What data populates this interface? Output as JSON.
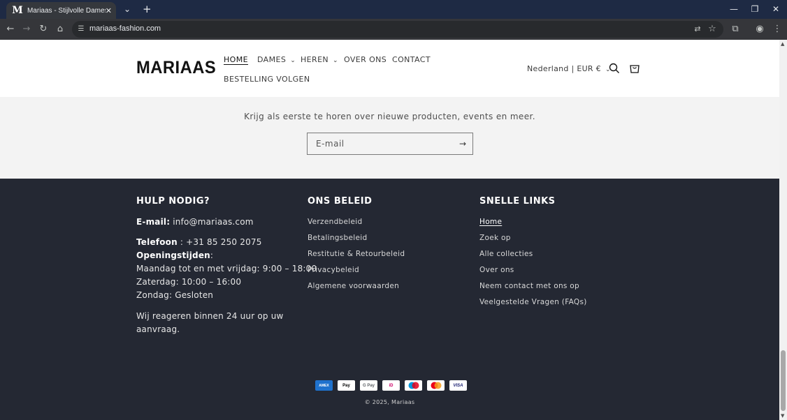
{
  "browser": {
    "tab_favicon": "M",
    "tab_title": "Mariaas - Stijlvolle Dames- & H",
    "tab_close": "✕",
    "tab_list": "⌄",
    "new_tab": "+",
    "url": "mariaas-fashion.com",
    "window": {
      "minimize": "—",
      "restore": "❐",
      "close": "✕"
    },
    "nav_icons": {
      "back": "←",
      "forward": "→",
      "reload": "↻",
      "home": "⌂",
      "site_info": "☰",
      "translate": "⇄",
      "bookmark": "☆",
      "extensions": "⧉",
      "profile": "◉",
      "menu": "⋮"
    }
  },
  "header": {
    "logo": "MARIAAS",
    "menu": [
      {
        "label": "HOME",
        "active": true
      },
      {
        "label": "DAMES",
        "dropdown": true
      },
      {
        "label": "HEREN",
        "dropdown": true
      },
      {
        "label": "OVER ONS"
      },
      {
        "label": "CONTACT"
      },
      {
        "label": "BESTELLING VOLGEN"
      }
    ],
    "chevron": "⌄",
    "locale": "Nederland | EUR €"
  },
  "newsletter": {
    "text": "Krijg als eerste te horen over nieuwe producten, events en meer.",
    "placeholder": "E-mail",
    "submit_arrow": "→"
  },
  "footer": {
    "help": {
      "title": "HULP NODIG?",
      "email_label": "E-mail:",
      "email": " info@mariaas.com",
      "phone_label": "Telefoon",
      "phone": " : +31 85 250 2075",
      "hours_label": "Openingstijden",
      "hours_colon": ":",
      "weekdays": "Maandag tot en met vrijdag: 9:00 – 18:00",
      "saturday": "Zaterdag: 10:00 – 16:00",
      "sunday": "Zondag: Gesloten",
      "response_1": "Wij reageren binnen 24 uur op uw",
      "response_2": "aanvraag."
    },
    "policy": {
      "title": "ONS BELEID",
      "links": [
        "Verzendbeleid",
        "Betalingsbeleid",
        "Restitutie & Retourbeleid",
        "Privacybeleid",
        "Algemene voorwaarden"
      ]
    },
    "quick": {
      "title": "SNELLE LINKS",
      "links": [
        "Home",
        "Zoek op",
        "Alle collecties",
        "Over ons",
        "Neem contact met ons op",
        "Veelgestelde Vragen (FAQs)"
      ]
    },
    "payments": [
      {
        "name": "American Express",
        "label": "AMEX",
        "icon": "amex-icon"
      },
      {
        "name": "Apple Pay",
        "label": " Pay",
        "icon": "apple-pay-icon"
      },
      {
        "name": "Google Pay",
        "label": "G Pay",
        "icon": "google-pay-icon"
      },
      {
        "name": "iDEAL",
        "label": "iD",
        "icon": "ideal-icon"
      },
      {
        "name": "Maestro",
        "label": "",
        "icon": "maestro-icon"
      },
      {
        "name": "Mastercard",
        "label": "",
        "icon": "mastercard-icon"
      },
      {
        "name": "Visa",
        "label": "VISA",
        "icon": "visa-icon"
      }
    ],
    "copyright": "© 2025, Mariaas"
  },
  "colors": {
    "footer_bg": "#242833",
    "newsletter_bg": "#f3f3f3",
    "header_bg": "#ffffff",
    "tabbar_bg": "#1e2a44"
  }
}
